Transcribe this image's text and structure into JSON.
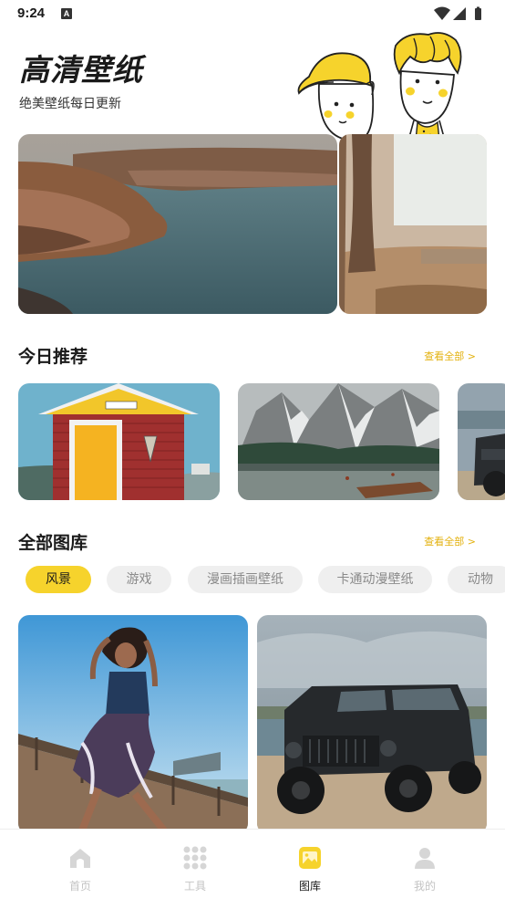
{
  "status_bar": {
    "time": "9:24",
    "notification_glyph": "A",
    "icons": [
      "wifi-icon",
      "signal-icon",
      "battery-icon"
    ]
  },
  "hero": {
    "title": "高清壁纸",
    "subtitle": "绝美壁纸每日更新"
  },
  "recommend": {
    "title": "今日推荐",
    "see_all": "查看全部 >"
  },
  "gallery": {
    "title": "全部图库",
    "see_all": "查看全部 >",
    "categories": [
      "风景",
      "游戏",
      "漫画插画壁纸",
      "卡通动漫壁纸",
      "动物"
    ],
    "selected": "风景"
  },
  "bottom_nav": {
    "items": [
      {
        "label": "首页",
        "icon": "home-icon"
      },
      {
        "label": "工具",
        "icon": "grid-icon"
      },
      {
        "label": "图库",
        "icon": "gallery-icon"
      },
      {
        "label": "我的",
        "icon": "profile-icon"
      }
    ],
    "active": "图库"
  },
  "colors": {
    "accent": "#f6d32c",
    "link": "#e3b10e",
    "inactive": "#c3c3c3"
  }
}
